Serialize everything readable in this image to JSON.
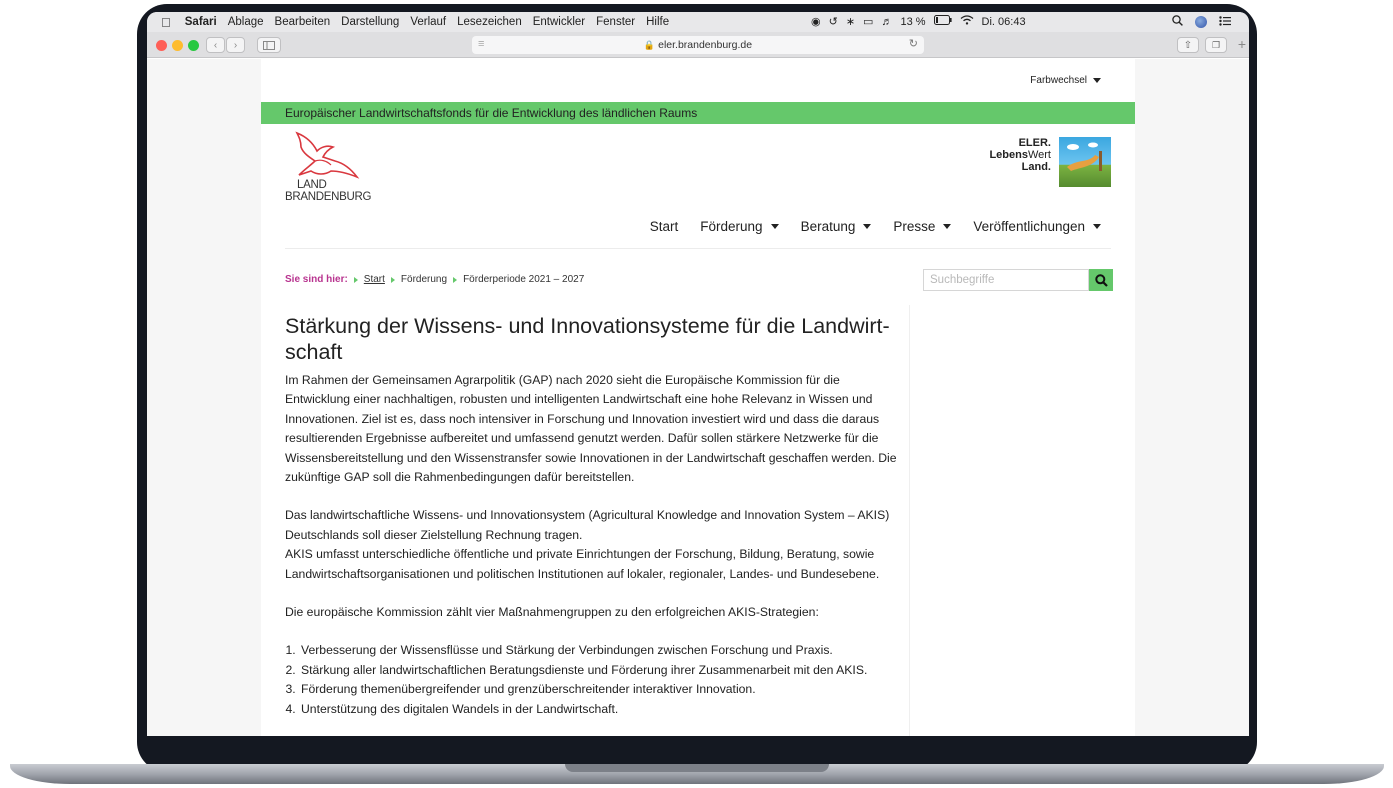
{
  "menubar": {
    "items": [
      "Safari",
      "Ablage",
      "Bearbeiten",
      "Darstellung",
      "Verlauf",
      "Lesezeichen",
      "Entwickler",
      "Fenster",
      "Hilfe"
    ],
    "battery": "13 %",
    "clock": "Di. 06:43"
  },
  "browser": {
    "url": "eler.brandenburg.de"
  },
  "site": {
    "farbwechsel": "Farbwechsel",
    "banner": "Europäischer Landwirtschaftsfonds für die Entwicklung des ländlichen Raums",
    "logo_line1": "LAND",
    "logo_line2": "BRANDENBURG",
    "eler_line1": "ELER.",
    "eler_line2_bold": "Lebens",
    "eler_line2_rest": "Wert",
    "eler_line3": "Land.",
    "nav": [
      "Start",
      "Förderung",
      "Beratung",
      "Presse",
      "Veröffentlichungen"
    ],
    "breadcrumb_label": "Sie sind hier:",
    "breadcrumb": [
      "Start",
      "Förderung",
      "Förderperiode 2021 – 2027"
    ],
    "search_placeholder": "Suchbegriffe",
    "colors": {
      "green": "#65c86b",
      "magenta": "#b8338f"
    }
  },
  "article": {
    "title_line1": "Stärkung der Wissens- und Innovationsysteme für die Landwirt-",
    "title_line2": "schaft",
    "p1": "Im Rahmen der Gemeinsamen Agrarpolitik (GAP) nach 2020 sieht die Europäische Kommission für die Entwicklung einer nachhaltigen, robusten und intelligenten Landwirtschaft eine hohe Relevanz in Wissen und Innovationen. Ziel ist es, dass noch intensiver in Forschung und Innovation investiert wird und dass die daraus resultierenden Ergebnisse aufbereitet und umfassend genutzt werden. Dafür sollen stärkere Netzwerke für die Wissensbereitstellung und den Wissenstransfer sowie Innovationen in der Landwirtschaft geschaffen werden. Die zukünftige GAP soll die Rahmenbedingungen dafür bereitstellen.",
    "p2a": "Das landwirtschaftliche Wissens- und Innovationsystem (Agricultural Knowledge and Innovation System – AKIS) Deutschlands soll dieser Zielstellung Rechnung tragen.",
    "p2b": "AKIS umfasst unterschiedliche öffentliche und private Einrichtungen der Forschung, Bildung, Beratung, sowie Landwirtschaftsorganisationen und politischen Institutionen auf lokaler, regionaler, Landes- und Bundesebene.",
    "p3": "Die europäische Kommission zählt vier Maßnahmengruppen zu den erfolgreichen AKIS-Strategien:",
    "list": [
      "Verbesserung der Wissensflüsse und Stärkung der Verbindungen zwischen Forschung und Praxis.",
      "Stärkung aller landwirtschaftlichen Beratungsdienste und Förderung ihrer Zusammenarbeit mit den AKIS.",
      "Förderung themenübergreifender und grenzüberschreitender interaktiver Innovation.",
      "Unterstützung des digitalen Wandels in der Landwirtschaft."
    ]
  }
}
